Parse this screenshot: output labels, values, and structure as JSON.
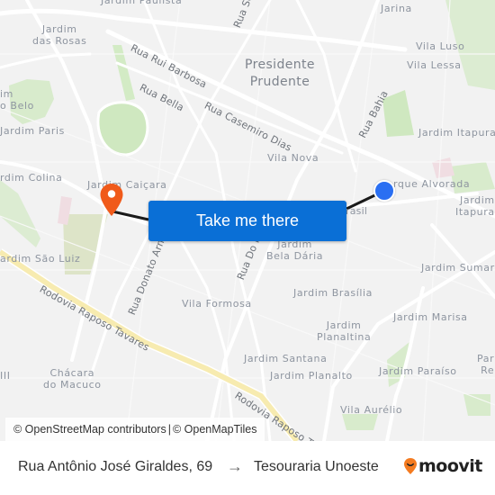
{
  "map": {
    "neighborhoods": [
      {
        "id": "jardim-paulista",
        "text": "Jardim Paulista"
      },
      {
        "id": "jardim-das-rosas",
        "text": "Jardim\ndas Rosas"
      },
      {
        "id": "jarina",
        "text": "Jarina"
      },
      {
        "id": "vila-luso",
        "text": "Vila Luso"
      },
      {
        "id": "vila-lessa",
        "text": "Vila Lessa"
      },
      {
        "id": "jardim-belo",
        "text": "im\no Belo"
      },
      {
        "id": "jardim-paris",
        "text": "Jardim Paris"
      },
      {
        "id": "jardim-itapura-top",
        "text": "Jardim Itapura"
      },
      {
        "id": "vila-nova",
        "text": "Vila Nova"
      },
      {
        "id": "jardim-colina",
        "text": "rdim Colina"
      },
      {
        "id": "jardim-caicara",
        "text": "Jardim Caiçara"
      },
      {
        "id": "parque-alvorada",
        "text": "rque Alvorada"
      },
      {
        "id": "jardim-itapura-right",
        "text": "Jardim\nItapura"
      },
      {
        "id": "jardim-bela-daria",
        "text": "Jardim\nBela Dária"
      },
      {
        "id": "jardim-sao-luiz",
        "text": "ardim São Luiz"
      },
      {
        "id": "jardim-sumare",
        "text": "Jardim Sumar"
      },
      {
        "id": "jardim-brasilia",
        "text": "Jardim Brasília"
      },
      {
        "id": "vila-formosa",
        "text": "Vila Formosa"
      },
      {
        "id": "jardim-marisa",
        "text": "Jardim Marisa"
      },
      {
        "id": "jardim-planaltina",
        "text": "Jardim\nPlanaltina"
      },
      {
        "id": "jardim-santana",
        "text": "Jardim Santana"
      },
      {
        "id": "jardim-planalto",
        "text": "Jardim Planalto"
      },
      {
        "id": "jardim-paraiso",
        "text": "Jardim Paraíso"
      },
      {
        "id": "parque-re",
        "text": "Par\nRe"
      },
      {
        "id": "chacara-do-macuco",
        "text": "Chácara\ndo Macuco"
      },
      {
        "id": "vila-aurelio",
        "text": "Vila Aurélio"
      },
      {
        "id": "iii",
        "text": "III"
      }
    ],
    "city_label": "Presidente\nPrudente",
    "streets": [
      {
        "id": "rua-se",
        "text": "Rua Se"
      },
      {
        "id": "rua-rui-barbosa",
        "text": "Rua Rui Barbosa"
      },
      {
        "id": "rua-bella",
        "text": "Rua Bella"
      },
      {
        "id": "rua-casemiro-dias",
        "text": "Rua Casemiro Dias"
      },
      {
        "id": "rua-bahia",
        "text": "Rua Bahia"
      },
      {
        "id": "rua-donato-armelin",
        "text": "Rua Donato Arm"
      },
      {
        "id": "rua-dom-foz",
        "text": "Rua Do     Foz"
      },
      {
        "id": "brasil",
        "text": "rasil"
      },
      {
        "id": "rodovia-raposo-tavares-1",
        "text": "Rodovia Raposo Tavares"
      },
      {
        "id": "rodovia-raposo-tavares-2",
        "text": "Rodovia Raposo T"
      }
    ],
    "take_me_there": "Take me there",
    "attribution": {
      "osm": "© OpenStreetMap contributors",
      "separator": "|",
      "omt": "© OpenMapTiles"
    },
    "colors": {
      "route": "#1a1a1a",
      "origin_pin": "#2a6ff2",
      "destination_pin": "#f05a1a",
      "button": "#0a6fd6",
      "highway": "#f7ebb0",
      "park": "#cfe8c0"
    }
  },
  "footer": {
    "from": "Rua Antônio José Giraldes, 69",
    "arrow": "→",
    "to": "Tesouraria Unoeste",
    "brand": "moovit"
  }
}
